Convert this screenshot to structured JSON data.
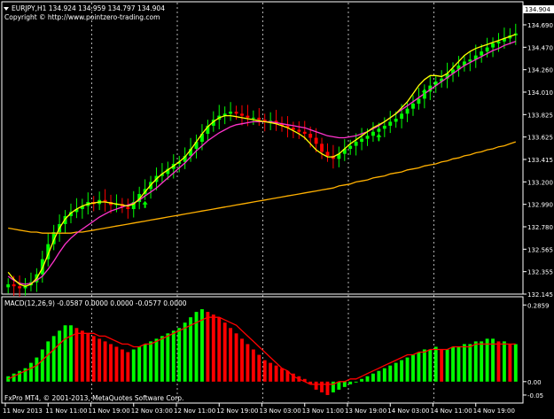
{
  "header": {
    "symbol_line": "EURJPY,H1  134.924 134.959 134.797 134.904",
    "copyright": "Copyright © http://www.pointzero-trading.com"
  },
  "indicator": {
    "label": "MACD(12,26,9) -0.0587 0.0000 0.0000 -0.0577 0.0000"
  },
  "footer": {
    "credit": "FxPro MT4, © 2001-2013, MetaQuotes Software Corp."
  },
  "colors": {
    "background": "#000000",
    "bull_candle": "#00ff00",
    "bear_candle": "#ff0000",
    "fast_ma": "#ffff00",
    "mid_ma": "#ff33cc",
    "slow_ma": "#ffb000",
    "macd_up": "#00ff00",
    "macd_down": "#ff0000",
    "signal_line": "#ff0000",
    "grid": "#ffffff",
    "current_price_box": "#ffffff"
  },
  "chart_data": [
    {
      "type": "candlestick",
      "symbol": "EURJPY",
      "timeframe": "H1",
      "ohlc_current": {
        "open": 134.924,
        "high": 134.959,
        "low": 134.797,
        "close": 134.904
      },
      "price_axis_ticks": [
        "134.690",
        "134.470",
        "134.260",
        "134.010",
        "133.825",
        "133.625",
        "133.415",
        "133.200",
        "132.990",
        "132.780",
        "132.565",
        "132.355",
        "132.145"
      ],
      "y_range": [
        132.12,
        134.98
      ],
      "time_axis_ticks": [
        "11 Nov 2013",
        "11 Nov 11:00",
        "11 Nov 19:00",
        "12 Nov 03:00",
        "12 Nov 11:00",
        "12 Nov 19:00",
        "13 Nov 03:00",
        "13 Nov 11:00",
        "13 Nov 19:00",
        "14 Nov 03:00",
        "14 Nov 11:00",
        "14 Nov 19:00"
      ],
      "current_price_label": "134.904",
      "close_series": [
        132.2,
        132.18,
        132.16,
        132.19,
        132.22,
        132.3,
        132.45,
        132.6,
        132.72,
        132.8,
        132.88,
        132.92,
        132.95,
        132.98,
        133.02,
        133.0,
        133.04,
        133.02,
        132.99,
        133.0,
        132.97,
        132.95,
        133.02,
        133.1,
        133.15,
        133.22,
        133.28,
        133.3,
        133.35,
        133.4,
        133.42,
        133.48,
        133.55,
        133.62,
        133.7,
        133.78,
        133.84,
        133.88,
        133.9,
        133.92,
        133.9,
        133.88,
        133.86,
        133.86,
        133.84,
        133.82,
        133.83,
        133.8,
        133.78,
        133.76,
        133.74,
        133.72,
        133.7,
        133.66,
        133.6,
        133.52,
        133.48,
        133.45,
        133.5,
        133.55,
        133.58,
        133.62,
        133.65,
        133.68,
        133.72,
        133.75,
        133.78,
        133.82,
        133.85,
        133.9,
        133.95,
        134.0,
        134.05,
        134.12,
        134.18,
        134.22,
        134.25,
        134.3,
        134.34,
        134.38,
        134.42,
        134.44,
        134.48,
        134.52,
        134.56,
        134.6,
        134.62,
        134.65,
        134.68,
        134.7
      ],
      "ma_fast_series": [
        132.32,
        132.25,
        132.2,
        132.18,
        132.2,
        132.26,
        132.36,
        132.5,
        132.64,
        132.76,
        132.85,
        132.91,
        132.95,
        132.98,
        133.0,
        133.01,
        133.02,
        133.02,
        133.01,
        133.0,
        132.99,
        132.98,
        133.0,
        133.05,
        133.12,
        133.19,
        133.25,
        133.3,
        133.34,
        133.38,
        133.42,
        133.47,
        133.54,
        133.62,
        133.7,
        133.77,
        133.82,
        133.86,
        133.88,
        133.88,
        133.87,
        133.86,
        133.85,
        133.84,
        133.83,
        133.82,
        133.81,
        133.8,
        133.78,
        133.76,
        133.73,
        133.7,
        133.66,
        133.6,
        133.54,
        133.5,
        133.47,
        133.47,
        133.5,
        133.55,
        133.6,
        133.64,
        133.68,
        133.72,
        133.76,
        133.79,
        133.82,
        133.86,
        133.9,
        133.96,
        134.02,
        134.1,
        134.18,
        134.24,
        134.28,
        134.28,
        134.27,
        134.3,
        134.36,
        134.42,
        134.48,
        134.52,
        134.55,
        134.57,
        134.59,
        134.61,
        134.63,
        134.65,
        134.67,
        134.69
      ],
      "ma_mid_series": [
        132.28,
        132.24,
        132.21,
        132.2,
        132.21,
        132.24,
        132.28,
        132.35,
        132.43,
        132.52,
        132.6,
        132.66,
        132.71,
        132.75,
        132.79,
        132.83,
        132.87,
        132.9,
        132.93,
        132.95,
        132.97,
        132.99,
        133.01,
        133.04,
        133.08,
        133.12,
        133.16,
        133.21,
        133.26,
        133.31,
        133.36,
        133.41,
        133.47,
        133.53,
        133.58,
        133.63,
        133.67,
        133.71,
        133.74,
        133.77,
        133.79,
        133.8,
        133.81,
        133.82,
        133.82,
        133.82,
        133.82,
        133.81,
        133.8,
        133.79,
        133.78,
        133.77,
        133.76,
        133.74,
        133.72,
        133.7,
        133.68,
        133.67,
        133.66,
        133.66,
        133.67,
        133.68,
        133.7,
        133.72,
        133.75,
        133.78,
        133.82,
        133.86,
        133.9,
        133.94,
        133.98,
        134.02,
        134.06,
        134.1,
        134.14,
        134.18,
        134.22,
        134.26,
        134.3,
        134.34,
        134.38,
        134.41,
        134.44,
        134.47,
        134.5,
        134.53,
        134.55,
        134.58,
        134.6,
        134.62
      ],
      "ma_slow_series": [
        132.76,
        132.75,
        132.74,
        132.73,
        132.72,
        132.72,
        132.71,
        132.71,
        132.71,
        132.71,
        132.71,
        132.71,
        132.72,
        132.72,
        132.73,
        132.74,
        132.75,
        132.76,
        132.77,
        132.78,
        132.79,
        132.8,
        132.81,
        132.82,
        132.83,
        132.84,
        132.85,
        132.86,
        132.87,
        132.88,
        132.89,
        132.9,
        132.91,
        132.92,
        132.93,
        132.94,
        132.95,
        132.96,
        132.97,
        132.98,
        132.99,
        133.0,
        133.01,
        133.02,
        133.03,
        133.04,
        133.05,
        133.06,
        133.07,
        133.08,
        133.09,
        133.1,
        133.11,
        133.12,
        133.13,
        133.14,
        133.15,
        133.16,
        133.18,
        133.19,
        133.2,
        133.22,
        133.23,
        133.24,
        133.26,
        133.27,
        133.28,
        133.3,
        133.31,
        133.32,
        133.34,
        133.35,
        133.36,
        133.38,
        133.39,
        133.4,
        133.42,
        133.43,
        133.45,
        133.46,
        133.48,
        133.49,
        133.51,
        133.52,
        133.54,
        133.55,
        133.57,
        133.58,
        133.6,
        133.62
      ]
    },
    {
      "type": "bar",
      "name": "MACD(12,26,9)",
      "axis_ticks": [
        "0.2859",
        "0.00",
        "-0.05"
      ],
      "y_range": [
        -0.07,
        0.3
      ],
      "histogram": [
        0.02,
        0.03,
        0.04,
        0.05,
        0.07,
        0.09,
        0.12,
        0.15,
        0.17,
        0.19,
        0.21,
        0.21,
        0.2,
        0.19,
        0.18,
        0.17,
        0.16,
        0.15,
        0.14,
        0.13,
        0.12,
        0.11,
        0.12,
        0.13,
        0.14,
        0.15,
        0.16,
        0.17,
        0.18,
        0.19,
        0.2,
        0.22,
        0.24,
        0.26,
        0.27,
        0.26,
        0.25,
        0.24,
        0.22,
        0.2,
        0.18,
        0.16,
        0.14,
        0.12,
        0.1,
        0.08,
        0.07,
        0.06,
        0.05,
        0.04,
        0.03,
        0.02,
        0.01,
        -0.01,
        -0.03,
        -0.04,
        -0.05,
        -0.04,
        -0.03,
        -0.02,
        -0.01,
        0.0,
        0.01,
        0.02,
        0.03,
        0.04,
        0.05,
        0.06,
        0.07,
        0.08,
        0.09,
        0.1,
        0.11,
        0.12,
        0.12,
        0.13,
        0.12,
        0.12,
        0.13,
        0.13,
        0.14,
        0.14,
        0.15,
        0.15,
        0.16,
        0.16,
        0.15,
        0.15,
        0.14,
        0.14
      ],
      "signal": [
        0.01,
        0.02,
        0.03,
        0.04,
        0.05,
        0.06,
        0.08,
        0.1,
        0.12,
        0.14,
        0.16,
        0.17,
        0.18,
        0.18,
        0.18,
        0.18,
        0.17,
        0.17,
        0.16,
        0.15,
        0.14,
        0.14,
        0.13,
        0.13,
        0.14,
        0.14,
        0.15,
        0.16,
        0.17,
        0.18,
        0.19,
        0.2,
        0.21,
        0.22,
        0.23,
        0.24,
        0.24,
        0.24,
        0.23,
        0.22,
        0.21,
        0.19,
        0.17,
        0.15,
        0.13,
        0.11,
        0.09,
        0.07,
        0.05,
        0.04,
        0.02,
        0.01,
        0.0,
        -0.01,
        -0.01,
        -0.01,
        -0.01,
        -0.01,
        0.0,
        0.0,
        0.01,
        0.01,
        0.02,
        0.03,
        0.04,
        0.05,
        0.06,
        0.07,
        0.08,
        0.09,
        0.1,
        0.1,
        0.11,
        0.11,
        0.12,
        0.12,
        0.12,
        0.12,
        0.13,
        0.13,
        0.13,
        0.13,
        0.14,
        0.14,
        0.14,
        0.14,
        0.14,
        0.14,
        0.14,
        0.14
      ]
    }
  ]
}
